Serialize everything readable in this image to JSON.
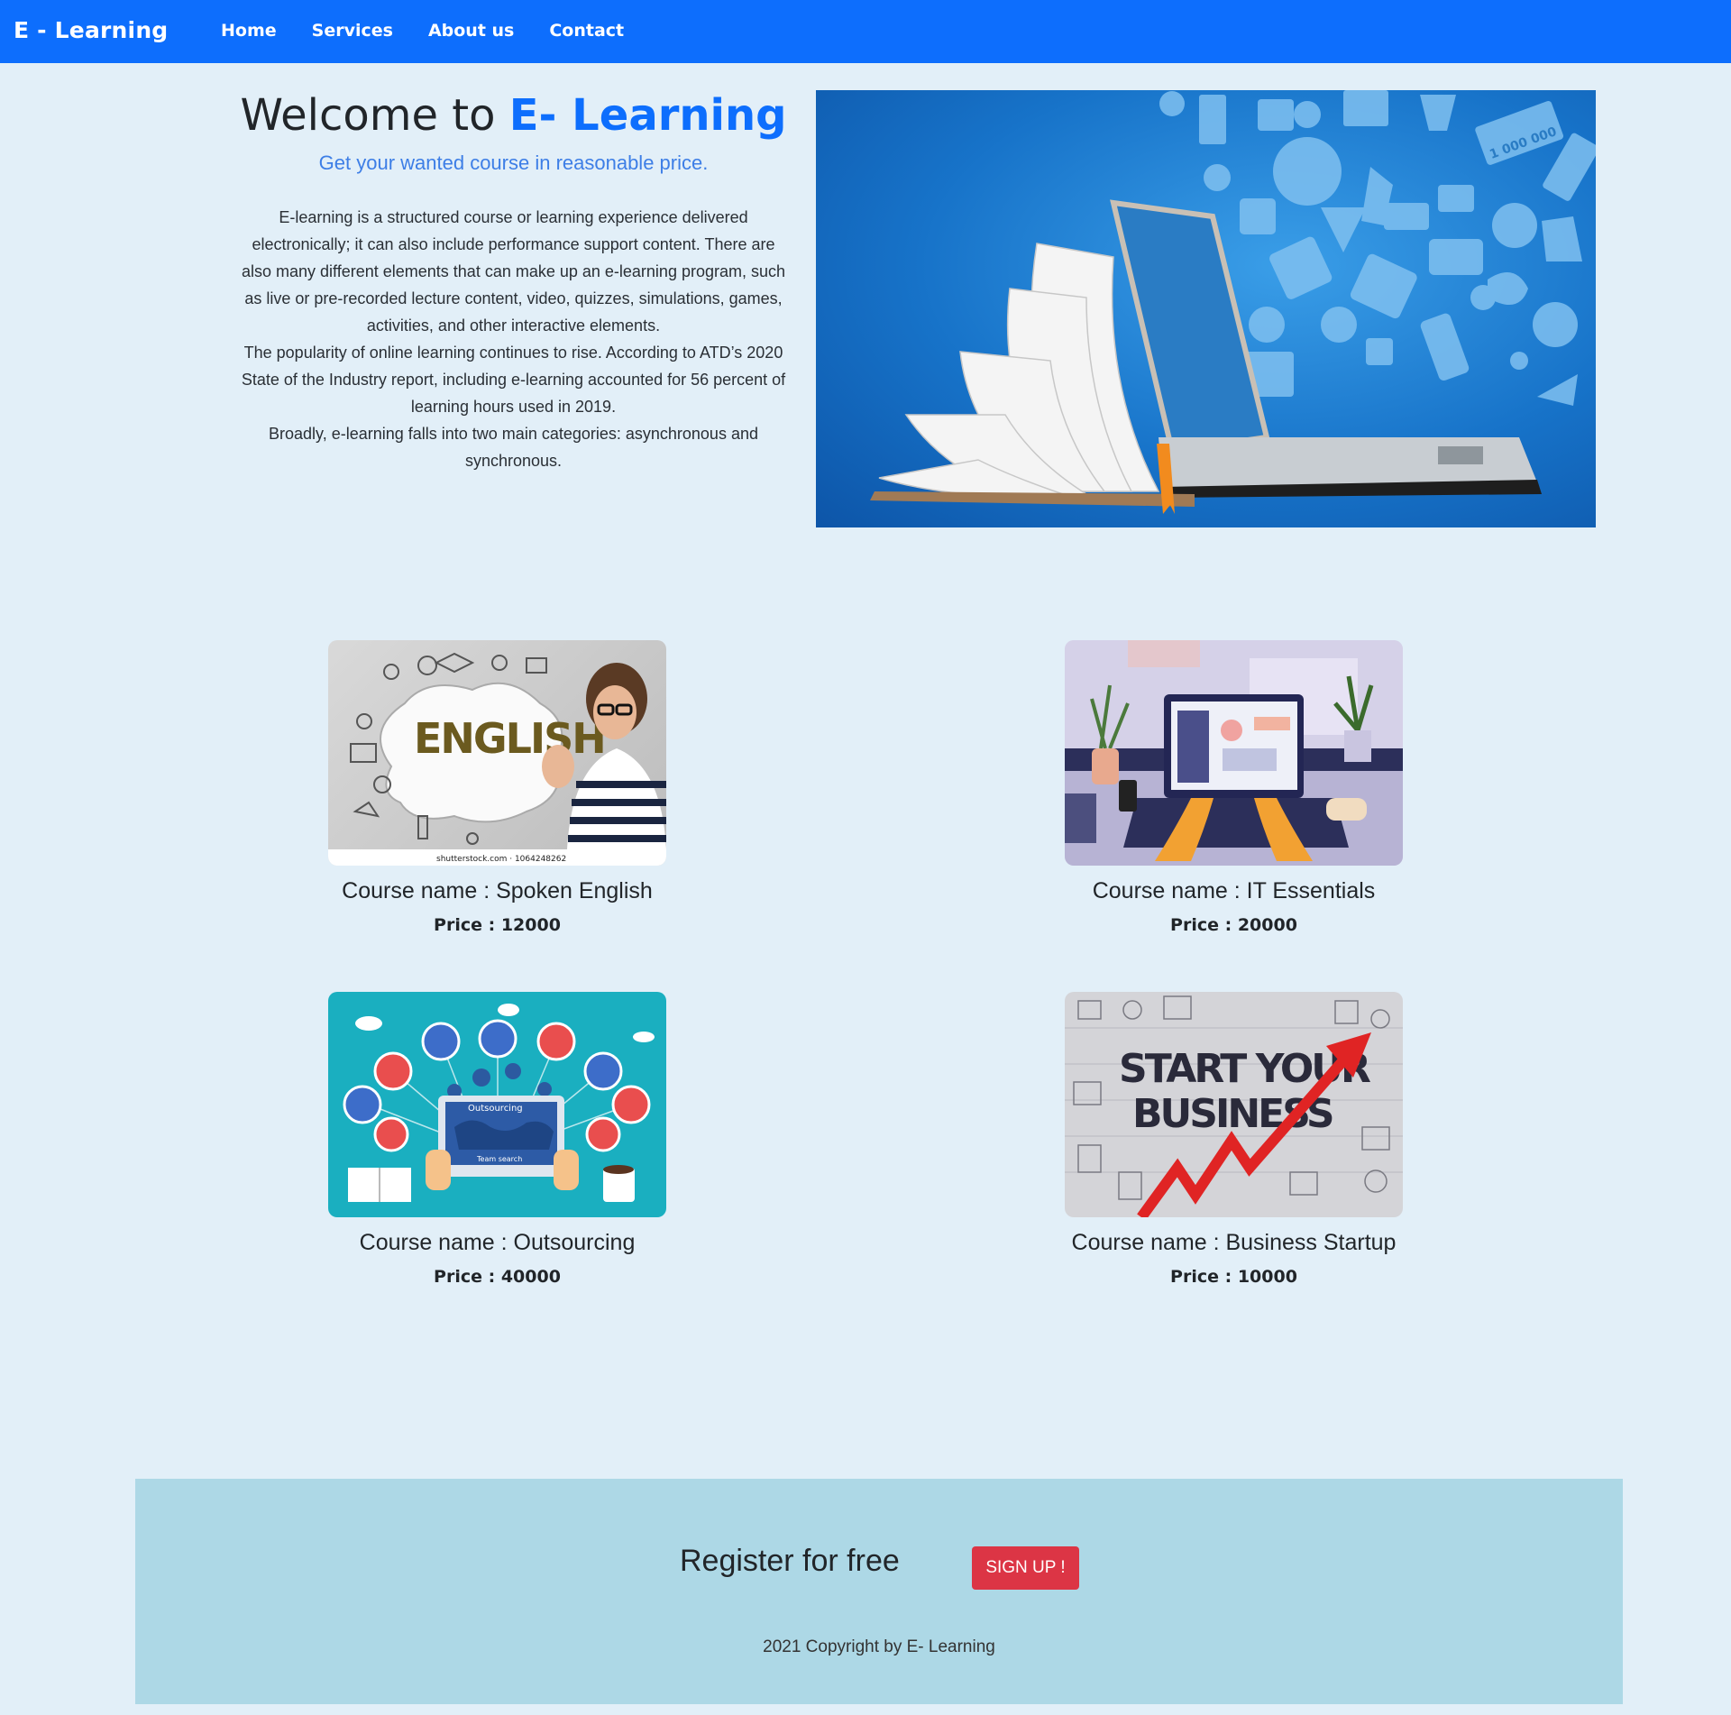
{
  "nav": {
    "brand": "E - Learning",
    "links": [
      "Home",
      "Services",
      "About us",
      "Contact"
    ]
  },
  "hero": {
    "title_prefix": "Welcome to",
    "title_accent": "E- Learning",
    "subtitle": "Get your wanted course in reasonable price.",
    "paragraph1": "E-learning is a structured course or learning experience delivered electronically; it can also include performance support content. There are also many different elements that can make up an e-learning program, such as live or pre-recorded lecture content, video, quizzes, simulations, games, activities, and other interactive elements.",
    "paragraph2": "The popularity of online learning continues to rise. According to ATD’s 2020 State of the Industry report, including e-learning accounted for 56 percent of learning hours used in 2019.",
    "paragraph3": "Broadly, e-learning falls into two main categories: asynchronous and synchronous."
  },
  "courses": [
    {
      "name": "Course name : Spoken English",
      "price": "Price : 12000",
      "image_text": "ENGLISH",
      "image_caption": "shutterstock.com · 1064248262"
    },
    {
      "name": "Course name : IT Essentials",
      "price": "Price : 20000"
    },
    {
      "name": "Course name : Outsourcing",
      "price": "Price : 40000",
      "image_text": "Outsourcing",
      "image_caption": "Team search"
    },
    {
      "name": "Course name : Business Startup",
      "price": "Price : 10000",
      "image_text_1": "START YOUR",
      "image_text_2": "BUSINESS"
    }
  ],
  "hero_image": {
    "label": "1 000 000"
  },
  "footer": {
    "register": "Register for free",
    "signup": "SIGN UP !",
    "copyright": "2021 Copyright by E- Learning"
  },
  "colors": {
    "primary": "#0d6efd",
    "background": "#e2eff8",
    "footer": "#add8e6",
    "signup": "#dc3545"
  }
}
